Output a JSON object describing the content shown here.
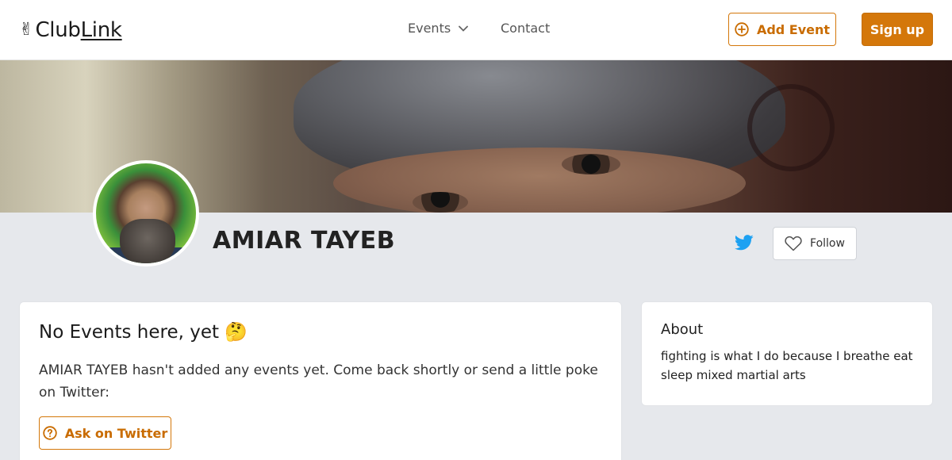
{
  "header": {
    "logo_hand": "✌",
    "logo_club": "Club",
    "logo_link": "Link",
    "nav_events": "Events",
    "nav_contact": "Contact",
    "add_event_label": "Add Event",
    "signup_label": "Sign up"
  },
  "profile": {
    "name": "AMIAR TAYEB",
    "follow_label": "Follow"
  },
  "events_card": {
    "title": "No Events here, yet 🤔",
    "message": "AMIAR TAYEB hasn't added any events yet. Come back shortly or send a little poke on Twitter:",
    "ask_label": "Ask on Twitter"
  },
  "about_card": {
    "title": "About",
    "text": "fighting is what I do because I breathe eat sleep mixed martial arts"
  },
  "colors": {
    "accent": "#d4770a",
    "twitter": "#1da1f2",
    "page_bg": "#e6e8ec"
  },
  "icons": {
    "add_event": "plus-circle-icon",
    "events_dropdown": "chevron-down-icon",
    "twitter": "twitter-icon",
    "follow": "heart-icon",
    "ask": "question-circle-icon"
  }
}
